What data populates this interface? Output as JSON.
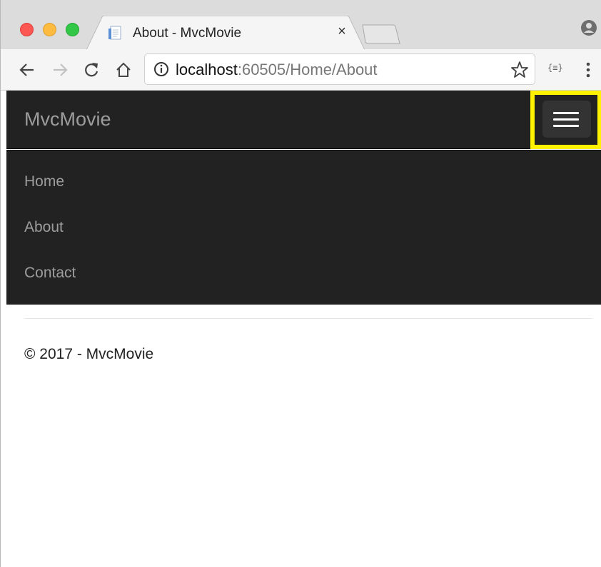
{
  "browser": {
    "tab": {
      "title": "About - MvcMovie",
      "close_glyph": "×"
    },
    "address_bar": {
      "host": "localhost",
      "rest": ":60505/Home/About"
    },
    "extension_label": "{≡}",
    "icons": [
      "back-icon",
      "forward-icon",
      "reload-icon",
      "home-icon",
      "info-icon",
      "star-icon",
      "profile-icon",
      "menu-dots-icon"
    ]
  },
  "navbar": {
    "brand": "MvcMovie",
    "links": [
      {
        "label": "Home"
      },
      {
        "label": "About"
      },
      {
        "label": "Contact"
      }
    ]
  },
  "footer": {
    "text": "© 2017 - MvcMovie"
  },
  "colors": {
    "navbar_bg": "#222222",
    "nav_text": "#9d9d9d",
    "highlight": "#fff200",
    "toggle_bg": "#333333"
  }
}
